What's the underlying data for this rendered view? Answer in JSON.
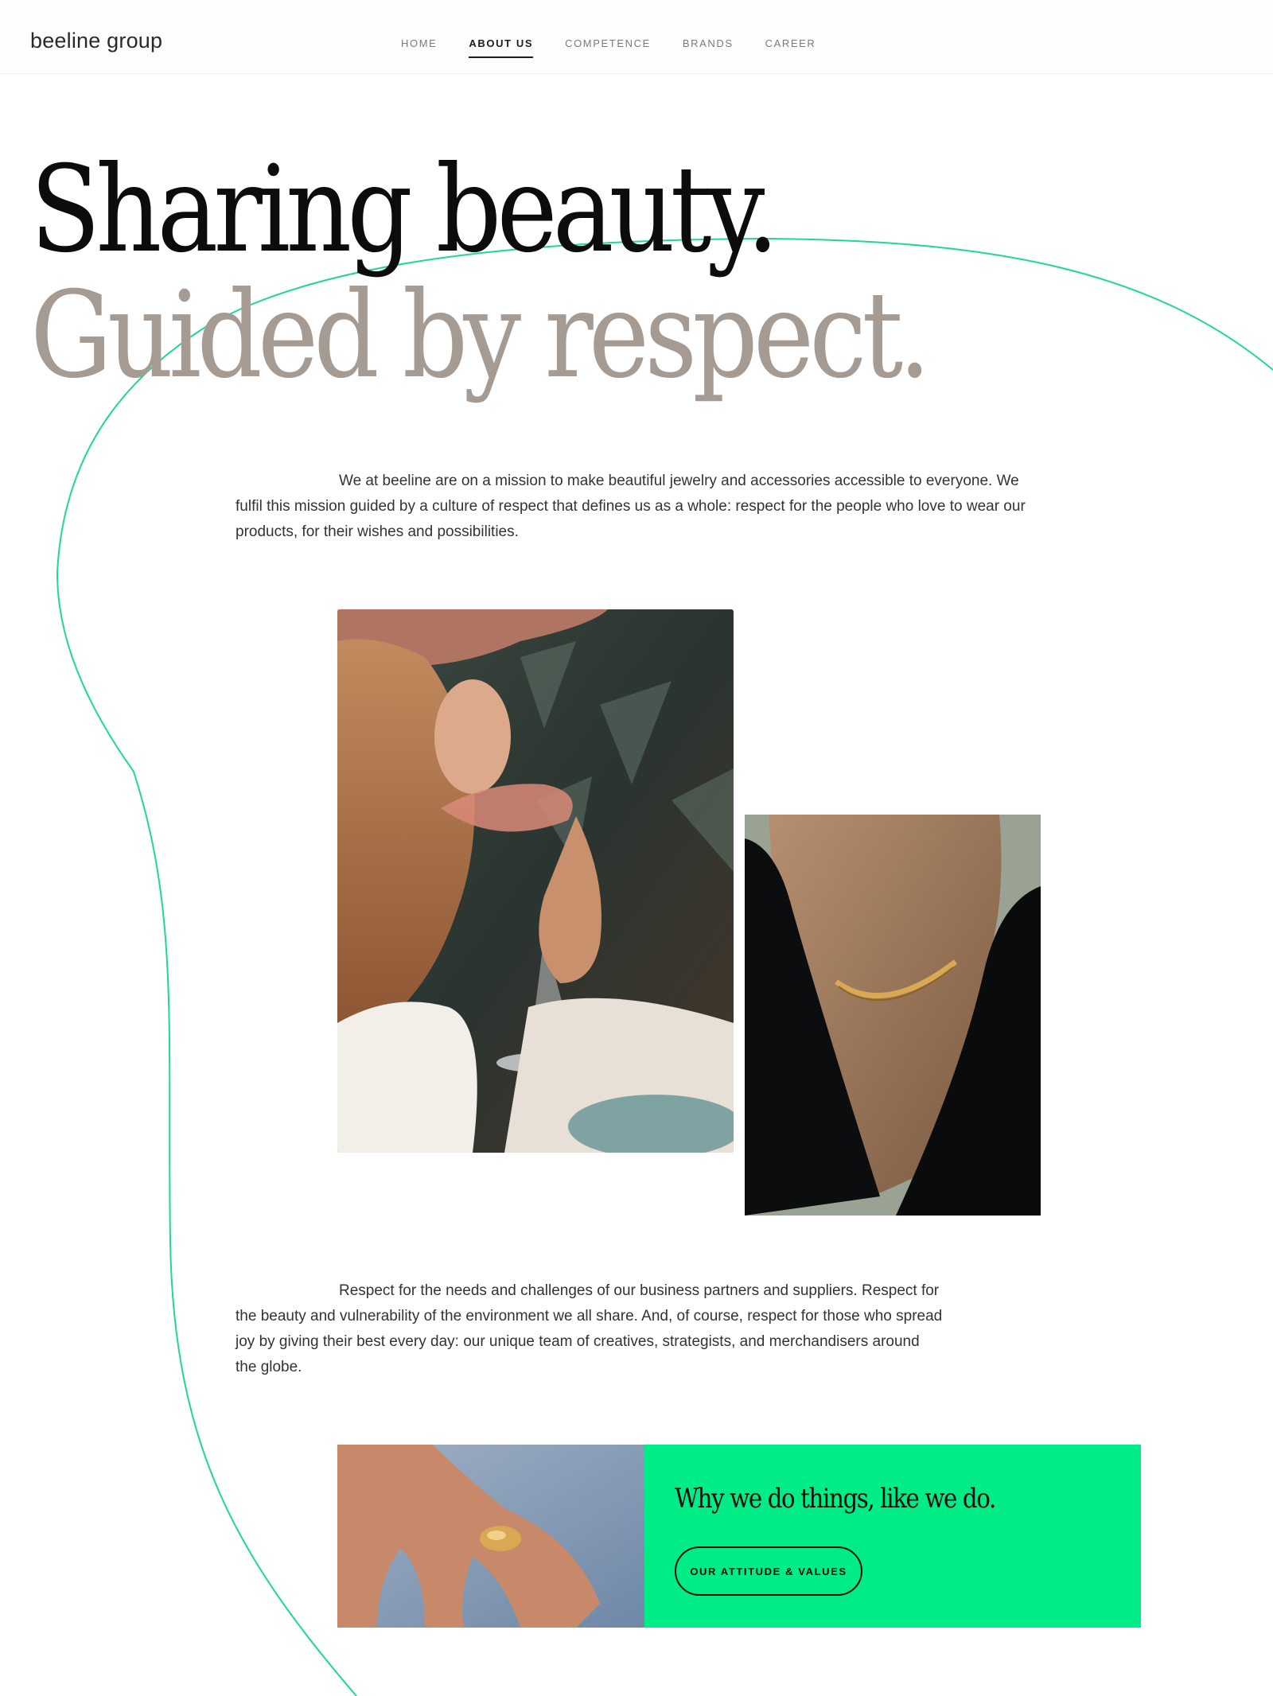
{
  "header": {
    "logo": "beeline group",
    "nav": [
      {
        "label": "HOME",
        "active": false
      },
      {
        "label": "ABOUT US",
        "active": true
      },
      {
        "label": "COMPETENCE",
        "active": false
      },
      {
        "label": "BRANDS",
        "active": false
      },
      {
        "label": "CAREER",
        "active": false
      }
    ]
  },
  "hero": {
    "line1": "Sharing beauty.",
    "line2": "Guided by respect."
  },
  "intro": {
    "first_line": "We at beeline are on a mission to make beautiful jewelry and accessories accessible to everyone.",
    "rest": "We fulfil this mission guided by a culture of respect that defines us as a whole: respect for the people who love to wear our products, for their wishes and possibilities."
  },
  "respect": {
    "first_line": "Respect for the needs and challenges of our business partners and suppliers.",
    "rest": "Respect for the beauty and vulnerability of the environment we all share. And, of course, respect for those who spread joy by giving their best every day: our unique team of creatives, strategists, and merchandisers around the globe."
  },
  "cta": {
    "title": "Why we do things, like we do.",
    "button_label": "OUR ATTITUDE & VALUES"
  },
  "images": {
    "drink": "photo-woman-drinking-cocktail",
    "neck": "photo-gold-necklace",
    "ring": "photo-hand-gold-ring"
  },
  "colors": {
    "accent_green": "#00ec87",
    "curve_line": "#1fd98f",
    "headline_dark": "#0c0c0c",
    "headline_taupe": "#a59b93",
    "body_text": "#333333"
  }
}
